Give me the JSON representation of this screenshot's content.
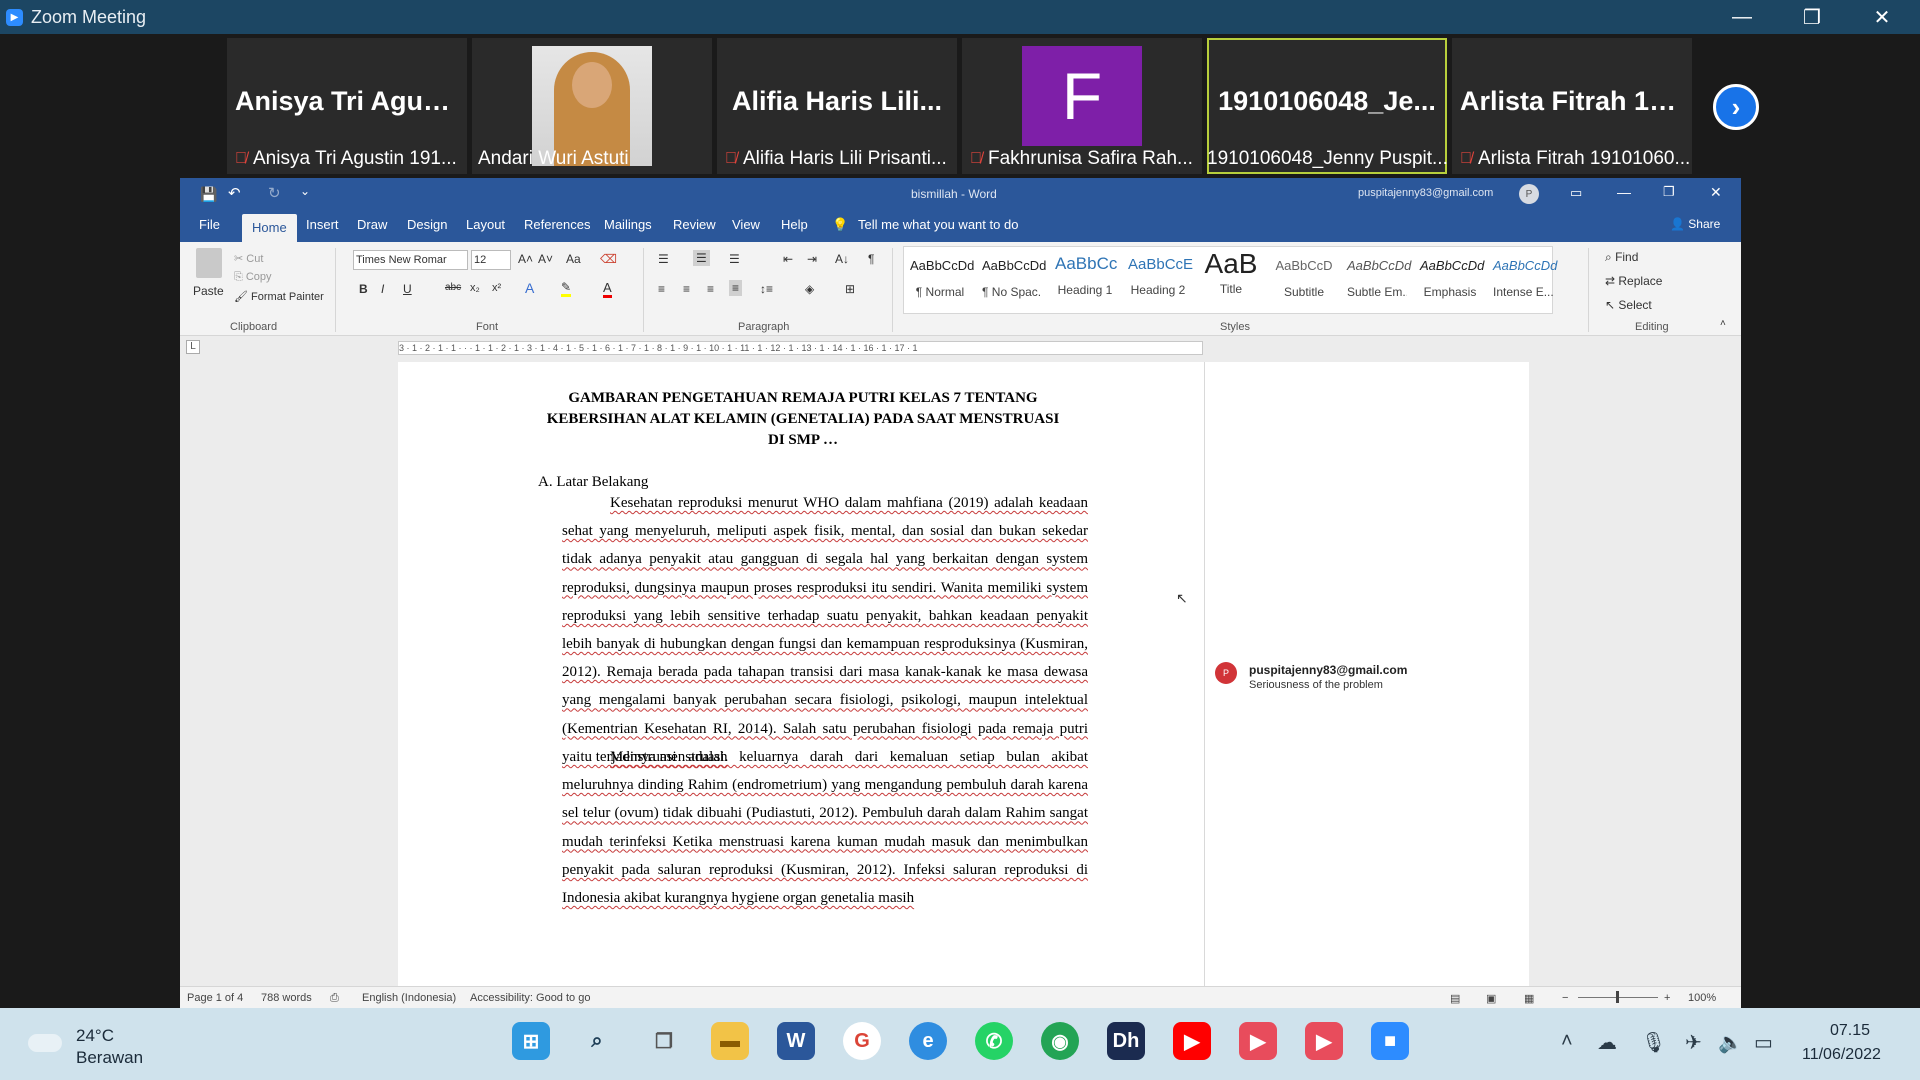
{
  "window": {
    "title": "Zoom Meeting"
  },
  "participants": [
    {
      "big": "Anisya Tri Agus...",
      "name": "Anisya Tri Agustin 191...",
      "muted": true
    },
    {
      "big": "",
      "name": "Andari Wuri Astuti",
      "muted": false
    },
    {
      "big": "Alifia Haris Lili...",
      "name": "Alifia Haris Lili Prisanti...",
      "muted": true
    },
    {
      "big": "F",
      "name": "Fakhrunisa Safira Rah...",
      "muted": true
    },
    {
      "big": "1910106048_Je...",
      "name": "1910106048_Jenny Puspit...",
      "muted": false
    },
    {
      "big": "Arlista Fitrah 19...",
      "name": "Arlista Fitrah 19101060...",
      "muted": true
    }
  ],
  "word": {
    "title": "bismillah  -  Word",
    "account": "puspitajenny83@gmail.com",
    "account_initial": "P",
    "tabs": [
      "File",
      "Home",
      "Insert",
      "Draw",
      "Design",
      "Layout",
      "References",
      "Mailings",
      "Review",
      "View",
      "Help"
    ],
    "tell_me": "Tell me what you want to do",
    "share": "Share",
    "clipboard": {
      "paste": "Paste",
      "cut": "Cut",
      "copy": "Copy",
      "format_painter": "Format Painter",
      "label": "Clipboard"
    },
    "font": {
      "name": "Times New Romar",
      "size": "12",
      "label": "Font"
    },
    "paragraph_label": "Paragraph",
    "styles_label": "Styles",
    "styles": [
      {
        "preview": "AaBbCcDd",
        "name": "¶ Normal"
      },
      {
        "preview": "AaBbCcDd",
        "name": "¶ No Spac..."
      },
      {
        "preview": "AaBbCc",
        "name": "Heading 1"
      },
      {
        "preview": "AaBbCcE",
        "name": "Heading 2"
      },
      {
        "preview": "AaB",
        "name": "Title"
      },
      {
        "preview": "AaBbCcD",
        "name": "Subtitle"
      },
      {
        "preview": "AaBbCcDd",
        "name": "Subtle Em..."
      },
      {
        "preview": "AaBbCcDd",
        "name": "Emphasis"
      },
      {
        "preview": "AaBbCcDd",
        "name": "Intense E..."
      }
    ],
    "editing": {
      "find": "Find",
      "replace": "Replace",
      "select": "Select",
      "label": "Editing"
    },
    "ruler": "3 · 1 · 2 · 1 · 1 · ·   · 1 · 1 · 2 · 1 · 3 · 1 · 4 · 1 · 5 · 1 · 6 · 1 · 7 · 1 · 8 · 1 · 9 · 1 · 10 · 1 · 11 · 1 · 12 · 1 · 13 · 1 · 14 · 1   · 16 · 1 · 17 · 1"
  },
  "document": {
    "title_1": "GAMBARAN PENGETAHUAN REMAJA PUTRI KELAS 7 TENTANG",
    "title_2": "KEBERSIHAN ALAT KELAMIN (GENETALIA) PADA SAAT MENSTRUASI",
    "title_3": "DI SMP …",
    "heading": "A.   Latar Belakang",
    "para1": "Kesehatan reproduksi menurut WHO dalam mahfiana (2019) adalah keadaan sehat yang menyeluruh, meliputi aspek fisik, mental, dan sosial dan bukan sekedar tidak adanya penyakit atau gangguan di segala hal yang berkaitan dengan system reproduksi, dungsinya maupun proses resproduksi itu sendiri. Wanita memiliki system reproduksi yang lebih sensitive terhadap suatu penyakit, bahkan keadaan penyakit lebih banyak di hubungkan dengan fungsi dan kemampuan resproduksinya (Kusmiran, 2012). Remaja berada pada tahapan transisi dari masa kanak-kanak ke masa dewasa yang mengalami banyak perubahan secara fisiologi, psikologi, maupun intelektual (Kementrian Kesehatan RI, 2014). Salah satu perubahan fisiologi pada remaja putri yaitu terjadinya menstruasi.",
    "para2": "Menstruasi adalah keluarnya darah dari kemaluan setiap bulan akibat meluruhnya dinding Rahim (endrometrium) yang mengandung pembuluh darah karena sel telur (ovum) tidak dibuahi (Pudiastuti, 2012). Pembuluh darah dalam Rahim sangat mudah terinfeksi Ketika menstruasi karena kuman mudah masuk dan menimbulkan penyakit pada saluran reproduksi (Kusmiran, 2012). Infeksi saluran reproduksi di Indonesia akibat kurangnya hygiene organ genetalia masih"
  },
  "comment": {
    "initial": "P",
    "author": "puspitajenny83@gmail.com",
    "text": "Seriousness of the problem"
  },
  "status": {
    "page": "Page 1 of 4",
    "words": "788 words",
    "language": "English (Indonesia)",
    "accessibility": "Accessibility: Good to go",
    "zoom": "100%"
  },
  "taskbar": {
    "temp": "24°C",
    "condition": "Berawan",
    "time": "07.15",
    "date": "11/06/2022"
  }
}
